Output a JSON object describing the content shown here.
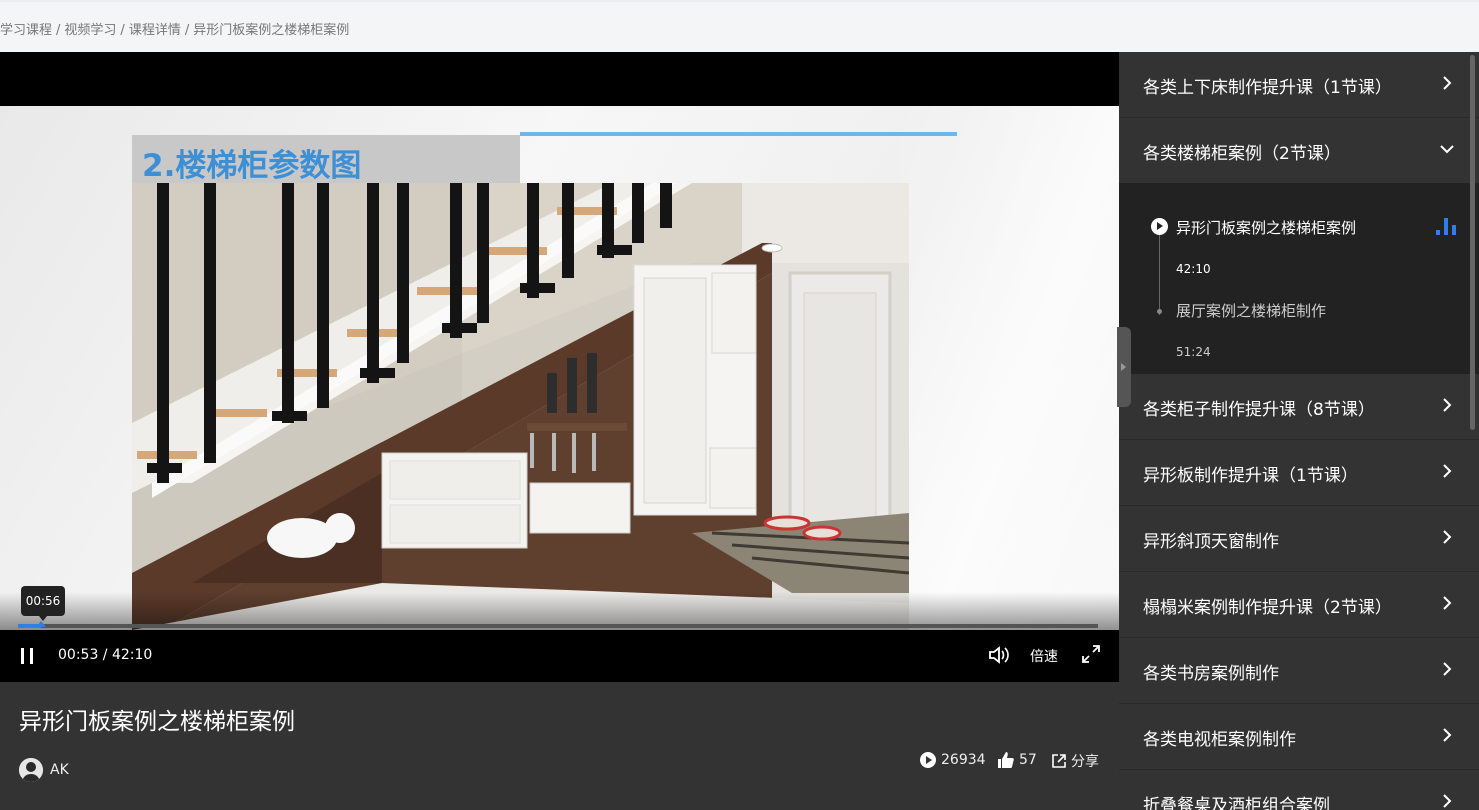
{
  "breadcrumb": [
    "学习课程",
    "视频学习",
    "课程详情",
    "异形门板案例之楼梯柜案例"
  ],
  "player": {
    "slide_title": "2.楼梯柜参数图",
    "hover_time": "00:56",
    "time_display": "00:53 / 42:10",
    "progress_fraction": 0.021,
    "speed_label": "倍速",
    "colors": {
      "progress": "#2f7fe5",
      "slide_title": "#3d8fd6",
      "accent_bar": "#6fb7ea"
    }
  },
  "video": {
    "title": "异形门板案例之楼梯柜案例",
    "author": "AK",
    "views": "26934",
    "likes": "57",
    "share_label": "分享"
  },
  "sidebar": {
    "sections": [
      {
        "label": "各类上下床制作提升课（1节课）",
        "icon": "chevron-right-icon"
      },
      {
        "label": "各类楼梯柜案例（2节课）",
        "icon": "chevron-down-icon"
      },
      {
        "label": "各类柜子制作提升课（8节课）",
        "icon": "chevron-right-icon"
      },
      {
        "label": "异形板制作提升课（1节课）",
        "icon": "chevron-right-icon"
      },
      {
        "label": "异形斜顶天窗制作",
        "icon": "chevron-right-icon"
      },
      {
        "label": "榻榻米案例制作提升课（2节课）",
        "icon": "chevron-right-icon"
      },
      {
        "label": "各类书房案例制作",
        "icon": "chevron-right-icon"
      },
      {
        "label": "各类电视柜案例制作",
        "icon": "chevron-right-icon"
      },
      {
        "label": "折叠餐桌及酒柜组合案例",
        "icon": "chevron-right-icon"
      }
    ],
    "lessons": [
      {
        "label": "异形门板案例之楼梯柜案例",
        "duration": "42:10",
        "playing": true
      },
      {
        "label": "展厅案例之楼梯柜制作",
        "duration": "51:24",
        "playing": false
      }
    ]
  }
}
